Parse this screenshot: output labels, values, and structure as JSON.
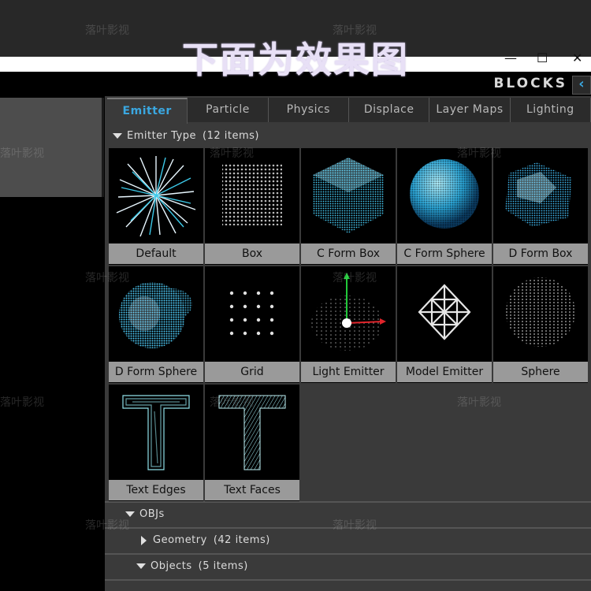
{
  "banner": "下面为效果图",
  "window": {
    "min": "—",
    "max": "☐",
    "close": "✕"
  },
  "panel_title": "BLOCKS",
  "collapse_glyph": "‹",
  "tabs": [
    "Emitter",
    "Particle",
    "Physics",
    "Displace",
    "Layer Maps",
    "Lighting"
  ],
  "active_tab": "Emitter",
  "sections": {
    "emitter_type": {
      "label": "Emitter Type",
      "count": "(12 items)"
    },
    "objs": {
      "label": "OBJs"
    },
    "geometry": {
      "label": "Geometry",
      "count": "(42 items)"
    },
    "objects": {
      "label": "Objects",
      "count": "(5 items)"
    }
  },
  "items": [
    {
      "label": "Default",
      "icon": "starburst-icon"
    },
    {
      "label": "Box",
      "icon": "particle-box-icon"
    },
    {
      "label": "C Form Box",
      "icon": "cform-box-icon"
    },
    {
      "label": "C Form Sphere",
      "icon": "cform-sphere-icon"
    },
    {
      "label": "D Form Box",
      "icon": "dform-box-icon"
    },
    {
      "label": "D Form Sphere",
      "icon": "dform-sphere-icon"
    },
    {
      "label": "Grid",
      "icon": "grid-icon"
    },
    {
      "label": "Light Emitter",
      "icon": "light-emitter-icon"
    },
    {
      "label": "Model Emitter",
      "icon": "model-emitter-icon"
    },
    {
      "label": "Sphere",
      "icon": "sphere-icon"
    },
    {
      "label": "Text Edges",
      "icon": "text-edges-icon"
    },
    {
      "label": "Text Faces",
      "icon": "text-faces-icon"
    }
  ],
  "watermark": "落叶影视",
  "colors": {
    "accent": "#3aa7e0",
    "label_bg": "#9a9a9a",
    "panel_bg": "#3a3a3a"
  }
}
